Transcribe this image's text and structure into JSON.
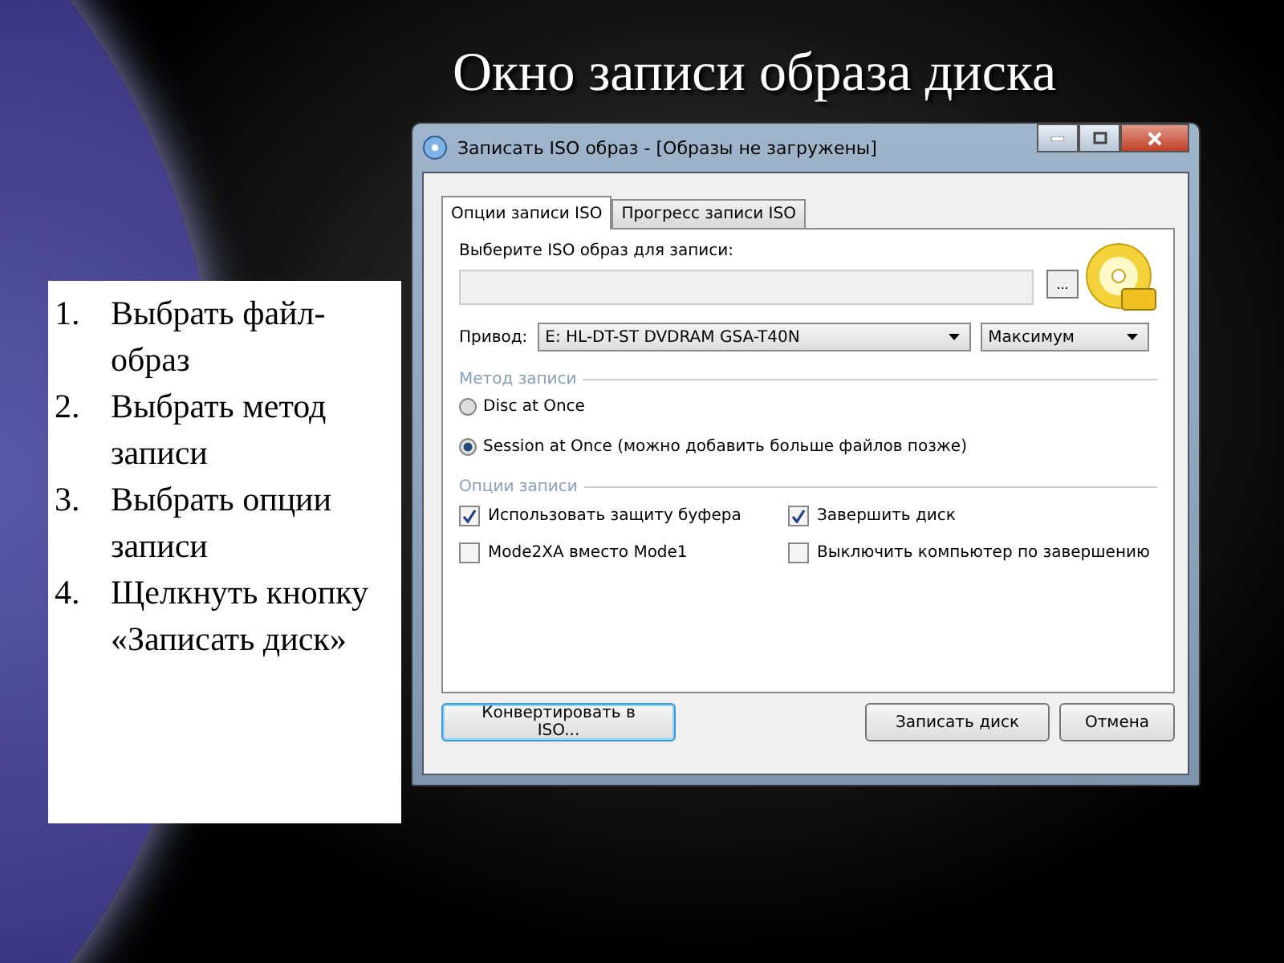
{
  "slide": {
    "title": "Окно записи образа диска",
    "steps": [
      {
        "number": "1.",
        "text": "Выбрать файл-образ"
      },
      {
        "number": "2.",
        "text": "Выбрать метод записи"
      },
      {
        "number": "3.",
        "text": "Выбрать опции записи"
      },
      {
        "number": "4.",
        "text": "Щелкнуть кнопку «Записать диск»"
      }
    ]
  },
  "window": {
    "title": "Записать ISO образ - [Образы не загружены]",
    "tabs": [
      {
        "label": "Опции записи ISO",
        "selected": true
      },
      {
        "label": "Прогресс записи ISO",
        "selected": false
      }
    ],
    "file_label": "Выберите ISO образ для записи:",
    "browse_button": "...",
    "drive_label": "Привод:",
    "drive": "E: HL-DT-ST DVDRAM GSA-T40N",
    "speed": "Максимум",
    "method_group": "Метод записи",
    "methods": [
      {
        "label": "Disc at Once",
        "selected": false
      },
      {
        "label": "Session at Once (можно добавить больше файлов позже)",
        "selected": true
      }
    ],
    "options_group": "Опции записи",
    "options": [
      {
        "label": "Использовать защиту буфера",
        "checked": true
      },
      {
        "label": "Завершить диск",
        "checked": true
      },
      {
        "label": "Mode2XA вместо Mode1",
        "checked": false
      },
      {
        "label": "Выключить компьютер по завершению",
        "checked": false
      }
    ],
    "buttons": [
      {
        "label": "Конвертировать в ISO...",
        "focused": true
      },
      {
        "label": "Записать диск",
        "focused": false
      },
      {
        "label": "Отмена",
        "focused": false
      }
    ]
  }
}
